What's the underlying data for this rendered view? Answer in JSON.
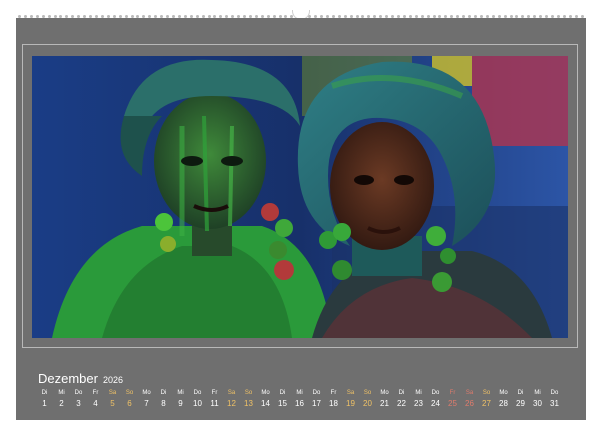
{
  "calendar": {
    "month": "Dezember",
    "year": "2026",
    "days": [
      {
        "wd": "Di",
        "d": "1",
        "type": "weekday"
      },
      {
        "wd": "Mi",
        "d": "2",
        "type": "weekday"
      },
      {
        "wd": "Do",
        "d": "3",
        "type": "weekday"
      },
      {
        "wd": "Fr",
        "d": "4",
        "type": "weekday"
      },
      {
        "wd": "Sa",
        "d": "5",
        "type": "sat"
      },
      {
        "wd": "So",
        "d": "6",
        "type": "sun"
      },
      {
        "wd": "Mo",
        "d": "7",
        "type": "weekday"
      },
      {
        "wd": "Di",
        "d": "8",
        "type": "weekday"
      },
      {
        "wd": "Mi",
        "d": "9",
        "type": "weekday"
      },
      {
        "wd": "Do",
        "d": "10",
        "type": "weekday"
      },
      {
        "wd": "Fr",
        "d": "11",
        "type": "weekday"
      },
      {
        "wd": "Sa",
        "d": "12",
        "type": "sat"
      },
      {
        "wd": "So",
        "d": "13",
        "type": "sun"
      },
      {
        "wd": "Mo",
        "d": "14",
        "type": "weekday"
      },
      {
        "wd": "Di",
        "d": "15",
        "type": "weekday"
      },
      {
        "wd": "Mi",
        "d": "16",
        "type": "weekday"
      },
      {
        "wd": "Do",
        "d": "17",
        "type": "weekday"
      },
      {
        "wd": "Fr",
        "d": "18",
        "type": "weekday"
      },
      {
        "wd": "Sa",
        "d": "19",
        "type": "sat"
      },
      {
        "wd": "So",
        "d": "20",
        "type": "sun"
      },
      {
        "wd": "Mo",
        "d": "21",
        "type": "weekday"
      },
      {
        "wd": "Di",
        "d": "22",
        "type": "weekday"
      },
      {
        "wd": "Mi",
        "d": "23",
        "type": "weekday"
      },
      {
        "wd": "Do",
        "d": "24",
        "type": "weekday"
      },
      {
        "wd": "Fr",
        "d": "25",
        "type": "hol"
      },
      {
        "wd": "Sa",
        "d": "26",
        "type": "hol"
      },
      {
        "wd": "So",
        "d": "27",
        "type": "sun"
      },
      {
        "wd": "Mo",
        "d": "28",
        "type": "weekday"
      },
      {
        "wd": "Di",
        "d": "29",
        "type": "weekday"
      },
      {
        "wd": "Mi",
        "d": "30",
        "type": "weekday"
      },
      {
        "wd": "Do",
        "d": "31",
        "type": "weekday"
      }
    ]
  },
  "colors": {
    "sheet": "#6f6f6f",
    "text": "#ffffff",
    "weekend": "#f0c266",
    "holiday": "#e07b6c"
  }
}
